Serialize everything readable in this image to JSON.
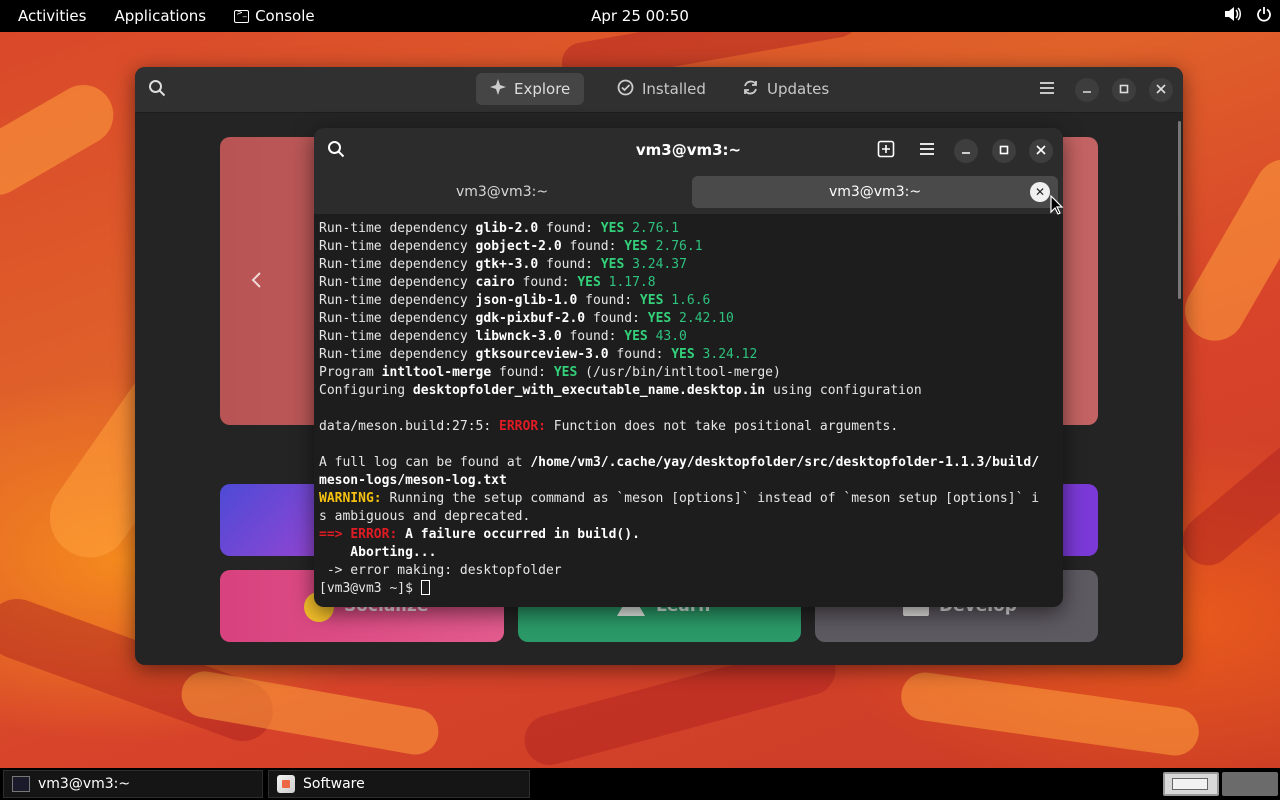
{
  "topbar": {
    "activities": "Activities",
    "applications": "Applications",
    "console": "Console",
    "clock": "Apr 25  00:50"
  },
  "software": {
    "tabs": [
      {
        "label": "Explore",
        "icon": "sparkle-icon"
      },
      {
        "label": "Installed",
        "icon": "check-circle-icon"
      },
      {
        "label": "Updates",
        "icon": "refresh-icon"
      }
    ],
    "cards": [
      {
        "label": "Socialize"
      },
      {
        "label": "Learn"
      },
      {
        "label": "Develop"
      }
    ]
  },
  "terminal": {
    "title": "vm3@vm3:~",
    "tabs": [
      {
        "label": "vm3@vm3:~"
      },
      {
        "label": "vm3@vm3:~"
      }
    ],
    "lines": [
      {
        "segments": [
          [
            "Run-time dependency ",
            ""
          ],
          [
            "glib-2.0",
            "b"
          ],
          [
            " found: ",
            ""
          ],
          [
            "YES",
            "g"
          ],
          [
            " 2.76.1",
            "v"
          ]
        ]
      },
      {
        "segments": [
          [
            "Run-time dependency ",
            ""
          ],
          [
            "gobject-2.0",
            "b"
          ],
          [
            " found: ",
            ""
          ],
          [
            "YES",
            "g"
          ],
          [
            " 2.76.1",
            "v"
          ]
        ]
      },
      {
        "segments": [
          [
            "Run-time dependency ",
            ""
          ],
          [
            "gtk+-3.0",
            "b"
          ],
          [
            " found: ",
            ""
          ],
          [
            "YES",
            "g"
          ],
          [
            " 3.24.37",
            "v"
          ]
        ]
      },
      {
        "segments": [
          [
            "Run-time dependency ",
            ""
          ],
          [
            "cairo",
            "b"
          ],
          [
            " found: ",
            ""
          ],
          [
            "YES",
            "g"
          ],
          [
            " 1.17.8",
            "v"
          ]
        ]
      },
      {
        "segments": [
          [
            "Run-time dependency ",
            ""
          ],
          [
            "json-glib-1.0",
            "b"
          ],
          [
            " found: ",
            ""
          ],
          [
            "YES",
            "g"
          ],
          [
            " 1.6.6",
            "v"
          ]
        ]
      },
      {
        "segments": [
          [
            "Run-time dependency ",
            ""
          ],
          [
            "gdk-pixbuf-2.0",
            "b"
          ],
          [
            " found: ",
            ""
          ],
          [
            "YES",
            "g"
          ],
          [
            " 2.42.10",
            "v"
          ]
        ]
      },
      {
        "segments": [
          [
            "Run-time dependency ",
            ""
          ],
          [
            "libwnck-3.0",
            "b"
          ],
          [
            " found: ",
            ""
          ],
          [
            "YES",
            "g"
          ],
          [
            " 43.0",
            "v"
          ]
        ]
      },
      {
        "segments": [
          [
            "Run-time dependency ",
            ""
          ],
          [
            "gtksourceview-3.0",
            "b"
          ],
          [
            " found: ",
            ""
          ],
          [
            "YES",
            "g"
          ],
          [
            " 3.24.12",
            "v"
          ]
        ]
      },
      {
        "segments": [
          [
            "Program ",
            ""
          ],
          [
            "intltool-merge",
            "b"
          ],
          [
            " found: ",
            ""
          ],
          [
            "YES",
            "g"
          ],
          [
            " (/usr/bin/intltool-merge)",
            ""
          ]
        ]
      },
      {
        "segments": [
          [
            "Configuring ",
            ""
          ],
          [
            "desktopfolder_with_executable_name.desktop.in",
            "b"
          ],
          [
            " using configuration",
            ""
          ]
        ]
      },
      {
        "segments": [
          [
            "",
            ""
          ]
        ]
      },
      {
        "segments": [
          [
            "data/meson.build:27:5: ",
            ""
          ],
          [
            "ERROR:",
            "r"
          ],
          [
            " Function does not take positional arguments.",
            ""
          ]
        ]
      },
      {
        "segments": [
          [
            "",
            ""
          ]
        ]
      },
      {
        "segments": [
          [
            "A full log can be found at ",
            ""
          ],
          [
            "/home/vm3/.cache/yay/desktopfolder/src/desktopfolder-1.1.3/build/",
            "b"
          ]
        ]
      },
      {
        "segments": [
          [
            "meson-logs/meson-log.txt",
            "b"
          ]
        ]
      },
      {
        "segments": [
          [
            "WARNING:",
            "y"
          ],
          [
            " Running the setup command as `meson [options]` instead of `meson setup [options]` i",
            ""
          ]
        ]
      },
      {
        "segments": [
          [
            "s ambiguous and deprecated.",
            ""
          ]
        ]
      },
      {
        "segments": [
          [
            "==> ",
            "r"
          ],
          [
            "ERROR:",
            "r"
          ],
          [
            " A failure occurred in build().",
            "b"
          ]
        ]
      },
      {
        "segments": [
          [
            "    Aborting...",
            "b"
          ]
        ]
      },
      {
        "segments": [
          [
            " -> error making: desktopfolder",
            ""
          ]
        ]
      },
      {
        "segments": [
          [
            "[vm3@vm3 ~]$ ",
            ""
          ]
        ]
      }
    ]
  },
  "taskbar": {
    "items": [
      {
        "label": "vm3@vm3:~"
      },
      {
        "label": "Software"
      }
    ]
  }
}
